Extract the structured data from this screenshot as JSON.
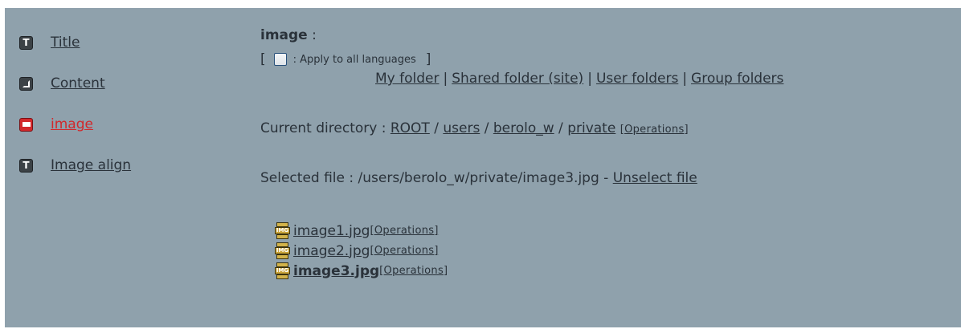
{
  "sidebar": {
    "items": [
      {
        "label": "Title",
        "icon": "text-field-icon"
      },
      {
        "label": "Content",
        "icon": "content-field-icon"
      },
      {
        "label": "image",
        "icon": "image-field-icon",
        "active": true
      },
      {
        "label": "Image align",
        "icon": "text-field-icon"
      }
    ]
  },
  "field": {
    "title": "image",
    "colon": " :",
    "apply_open": "[",
    "apply_label": ": Apply to all languages",
    "apply_close": "]"
  },
  "folders": {
    "my": "My folder",
    "shared": "Shared folder (site)",
    "users": "User folders",
    "groups": "Group folders",
    "separator": "|"
  },
  "current_directory": {
    "label": "Current directory :",
    "path": [
      "ROOT",
      "users",
      "berolo_w",
      "private"
    ],
    "path_separator": "/",
    "operations": "[Operations]"
  },
  "selected_file": {
    "label": "Selected file : /users/berolo_w/private/image3.jpg -",
    "unselect": "Unselect file"
  },
  "files": [
    {
      "name": "image1.jpg",
      "operations": "[Operations]",
      "selected": false
    },
    {
      "name": "image2.jpg",
      "operations": "[Operations]",
      "selected": false
    },
    {
      "name": "image3.jpg",
      "operations": "[Operations]",
      "selected": true
    }
  ],
  "colors": {
    "panel_bg": "#8fa1ac",
    "text": "#2a323a",
    "active": "#d2282b"
  }
}
